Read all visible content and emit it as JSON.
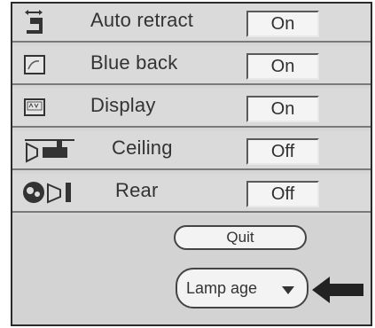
{
  "menu": {
    "rows": [
      {
        "label": "Auto retract",
        "value": "On",
        "icon": "auto-retract-icon"
      },
      {
        "label": "Blue back",
        "value": "On",
        "icon": "blue-back-icon"
      },
      {
        "label": "Display",
        "value": "On",
        "icon": "display-icon"
      },
      {
        "label": "Ceiling",
        "value": "Off",
        "icon": "ceiling-projector-icon"
      },
      {
        "label": "Rear",
        "value": "Off",
        "icon": "rear-projection-icon"
      }
    ],
    "quit_label": "Quit",
    "lamp_age_label": "Lamp age"
  },
  "colors": {
    "panel_bg": "#d6d6d6",
    "value_box_bg": "#f4f4f4",
    "arrow": "#222222"
  }
}
